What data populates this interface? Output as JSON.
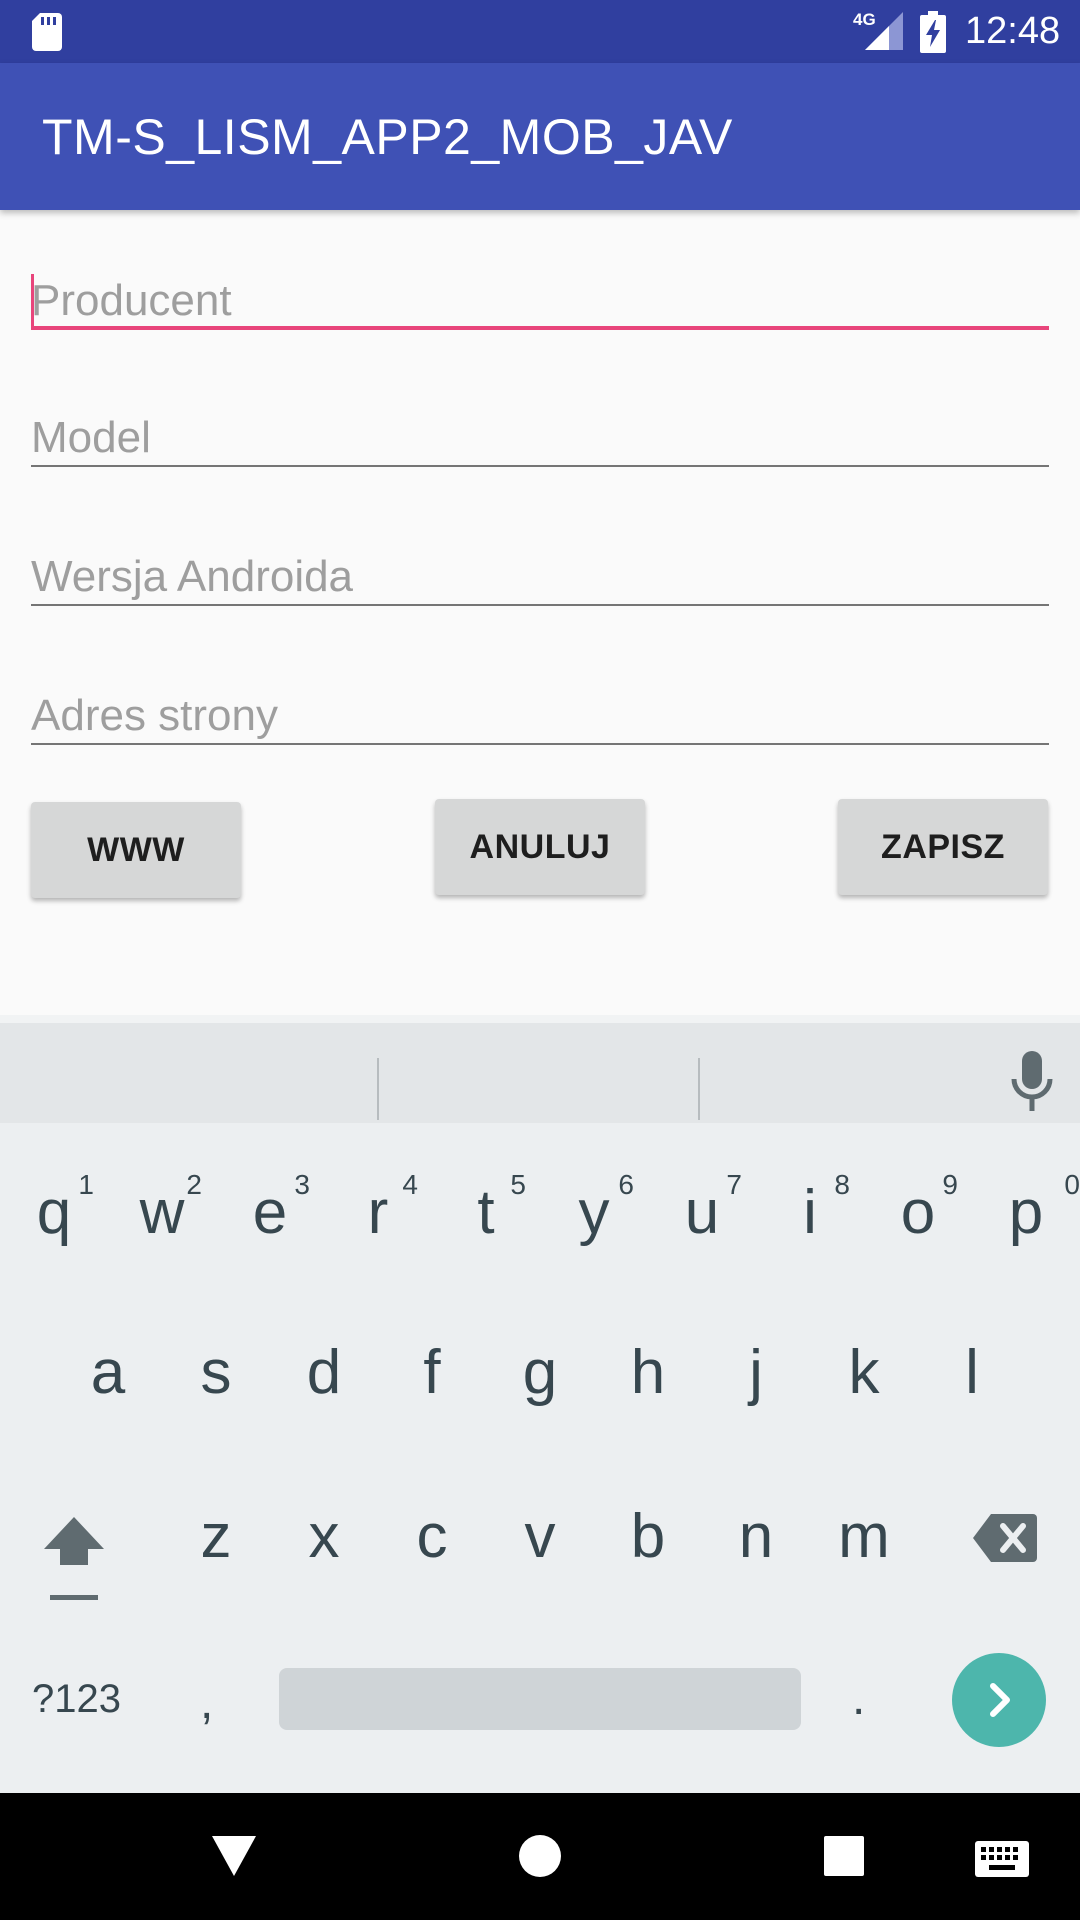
{
  "status_bar": {
    "network_label": "4G",
    "time": "12:48"
  },
  "app_bar": {
    "title": "TM-S_LISM_APP2_MOB_JAV"
  },
  "form": {
    "fields": [
      {
        "placeholder": "Producent",
        "value": "",
        "focused": true
      },
      {
        "placeholder": "Model",
        "value": ""
      },
      {
        "placeholder": "Wersja Androida",
        "value": ""
      },
      {
        "placeholder": "Adres strony",
        "value": ""
      }
    ],
    "buttons": {
      "www": "WWW",
      "cancel": "ANULUJ",
      "save": "ZAPISZ"
    }
  },
  "keyboard": {
    "row1": [
      {
        "k": "q",
        "n": "1"
      },
      {
        "k": "w",
        "n": "2"
      },
      {
        "k": "e",
        "n": "3"
      },
      {
        "k": "r",
        "n": "4"
      },
      {
        "k": "t",
        "n": "5"
      },
      {
        "k": "y",
        "n": "6"
      },
      {
        "k": "u",
        "n": "7"
      },
      {
        "k": "i",
        "n": "8"
      },
      {
        "k": "o",
        "n": "9"
      },
      {
        "k": "p",
        "n": "0"
      }
    ],
    "row2": [
      "a",
      "s",
      "d",
      "f",
      "g",
      "h",
      "j",
      "k",
      "l"
    ],
    "row3": [
      "z",
      "x",
      "c",
      "v",
      "b",
      "n",
      "m"
    ],
    "symbols_label": "?123",
    "comma": ",",
    "period": "."
  },
  "colors": {
    "status_bar": "#303f9f",
    "app_bar": "#3f51b5",
    "accent": "#e8457b",
    "go_key": "#4db6ac"
  }
}
